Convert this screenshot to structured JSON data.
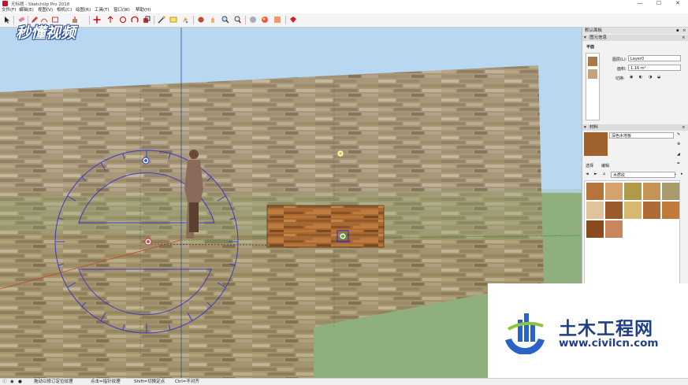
{
  "app": {
    "title": "无标题 - SketchUp Pro 2018",
    "window_controls": [
      "—",
      "☐",
      "✕"
    ]
  },
  "menu": [
    "文件(F)",
    "编辑(E)",
    "视图(V)",
    "相机(C)",
    "绘图(R)",
    "工具(T)",
    "窗口(W)",
    "帮助(H)"
  ],
  "toolbar": {
    "icons": [
      "select-icon",
      "eraser-icon",
      "pencil-icon",
      "shape-icon",
      "pushpull-icon",
      "move-icon",
      "rotate-icon",
      "scale-icon",
      "offset-icon",
      "tape-icon",
      "text-icon",
      "axes-icon",
      "paint-icon",
      "orbit-icon",
      "pan-icon",
      "zoom-icon",
      "zoom-extents-icon",
      "warehouse-icon",
      "extension-icon",
      "ruby-icon"
    ]
  },
  "colors": {
    "sky": "#b8d7f0",
    "ground": "#8fb07e",
    "accent": "#3a6db5",
    "protractor": "#3a3acc",
    "panel_bg": "#f2f2f2"
  },
  "watermark": {
    "text": "秒懂视频"
  },
  "panel": {
    "tray_title": "默认面板",
    "entity_info": {
      "header": "图元信息",
      "kind": "平面",
      "layer_label": "图层(L):",
      "layer_value": "Layer0",
      "area_label": "面积:",
      "area_value": "1.16 m²",
      "toggle_label": "切换:"
    },
    "materials": {
      "header": "材料",
      "name": "深色木地板",
      "tabs": [
        "选择",
        "编辑"
      ],
      "library": "木质纹"
    }
  },
  "statusbar": {
    "icons": [
      "info-icon",
      "geo-icon",
      "user-icon"
    ],
    "hint_1": "拖动以修订定位纹理",
    "hint_2": "点击=指针纹理",
    "hint_3": "Shift=切换定点",
    "hint_4": "Ctrl=不对齐"
  },
  "site_logo": {
    "name": "土木工程网",
    "url": "www.civilcn.com"
  }
}
